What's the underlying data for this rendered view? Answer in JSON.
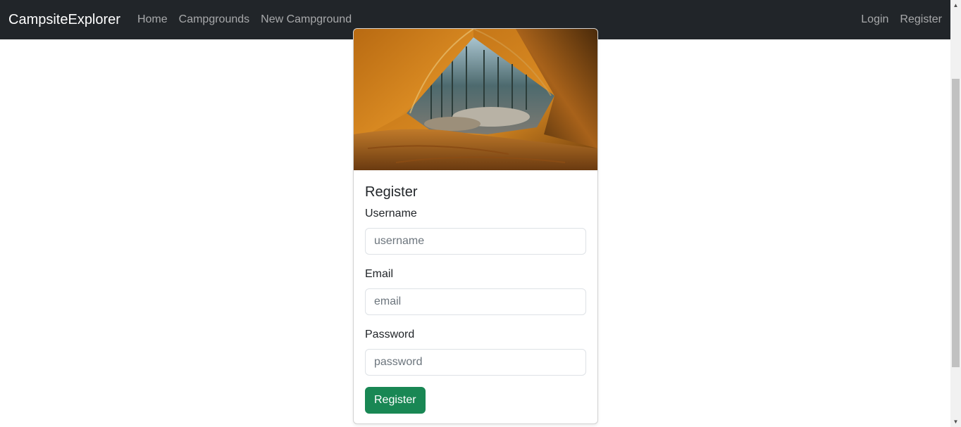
{
  "navbar": {
    "brand": "CampsiteExplorer",
    "links": [
      "Home",
      "Campgrounds",
      "New Campground"
    ],
    "right_links": [
      "Login",
      "Register"
    ]
  },
  "card": {
    "title": "Register",
    "fields": [
      {
        "label": "Username",
        "placeholder": "username"
      },
      {
        "label": "Email",
        "placeholder": "email"
      },
      {
        "label": "Password",
        "placeholder": "password"
      }
    ],
    "submit_label": "Register"
  },
  "colors": {
    "navbar_bg": "#212529",
    "button_success": "#198754"
  }
}
